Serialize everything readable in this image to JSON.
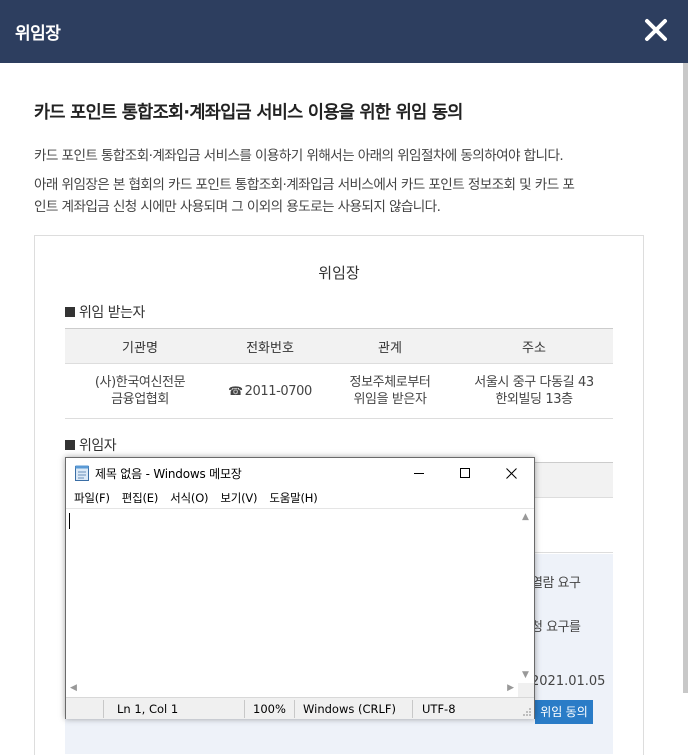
{
  "modal": {
    "title": "위임장",
    "heading": "카드 포인트 통합조회·계좌입금 서비스 이용을 위한 위임 동의",
    "paragraph1": "카드 포인트 통합조회·계좌입금 서비스를 이용하기 위해서는 아래의 위임절차에 동의하여야 합니다.",
    "paragraph2_line1": "아래 위임장은 본 협회의 카드 포인트 통합조회·계좌입금 서비스에서 카드 포인트 정보조회 및 카드 포",
    "paragraph2_line2": "인트 계좌입금 신청 시에만 사용되며 그 이외의 용도로는 사용되지 않습니다."
  },
  "document": {
    "title": "위임장",
    "section1": "위임 받는자",
    "section2": "위임자",
    "table1": {
      "headers": [
        "기관명",
        "전화번호",
        "관계",
        "주소"
      ],
      "row": {
        "org_line1": "(사)한국여신전문",
        "org_line2": "금융업협회",
        "phone_icon": "☎",
        "phone": "2011-0700",
        "relation_line1": "정보주체로부터",
        "relation_line2": "위임을 받은자",
        "address_line1": "서울시 중구 다동길 43",
        "address_line2": "한외빌딩 13층"
      }
    },
    "agree_text1": "열람 요구",
    "agree_text2": "청 요구를",
    "agree_date": "2021.01.05",
    "agree_button": "위임 동의"
  },
  "notepad": {
    "title": "제목 없음 - Windows 메모장",
    "menu": [
      "파일(F)",
      "편집(E)",
      "서식(O)",
      "보기(V)",
      "도움말(H)"
    ],
    "content": "",
    "status": {
      "position": "Ln 1, Col 1",
      "zoom": "100%",
      "line_ending": "Windows (CRLF)",
      "encoding": "UTF-8"
    }
  },
  "colors": {
    "header_bg": "#2d3e5f",
    "button_blue": "#2a7cc7",
    "agree_area_bg": "#eef2f9"
  }
}
